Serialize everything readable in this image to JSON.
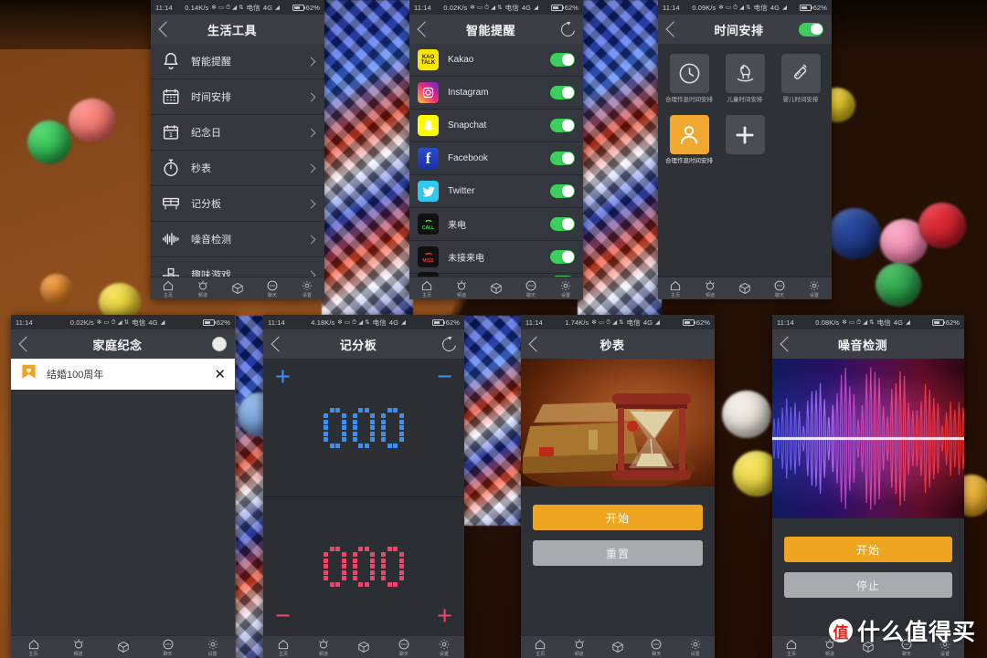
{
  "background": {
    "description": "colorful pom-pom balls on brown wooden table with blue and red LED light panel"
  },
  "watermark": {
    "logo_char": "值",
    "text": "什么值得买"
  },
  "status_bars": [
    {
      "time": "11:14",
      "net_speed": "0.14K/s",
      "carrier": "电信",
      "network": "4G",
      "battery": "62%"
    },
    {
      "time": "11:14",
      "net_speed": "0.02K/s",
      "carrier": "电信",
      "network": "4G",
      "battery": "62%"
    },
    {
      "time": "11:14",
      "net_speed": "0.09K/s",
      "carrier": "电信",
      "network": "4G",
      "battery": "62%"
    },
    {
      "time": "11:14",
      "net_speed": "0.02K/s",
      "carrier": "电信",
      "network": "4G",
      "battery": "62%"
    },
    {
      "time": "11:14",
      "net_speed": "4.18K/s",
      "carrier": "电信",
      "network": "4G",
      "battery": "62%"
    },
    {
      "time": "11:14",
      "net_speed": "1.74K/s",
      "carrier": "电信",
      "network": "4G",
      "battery": "62%"
    },
    {
      "time": "11:14",
      "net_speed": "0.08K/s",
      "carrier": "电信",
      "network": "4G",
      "battery": "62%"
    }
  ],
  "nav_bar": {
    "items": [
      {
        "label": "主页",
        "icon": "home-icon"
      },
      {
        "label": "频道",
        "icon": "brightness-icon"
      },
      {
        "label": "",
        "icon": "cube-icon"
      },
      {
        "label": "聊天",
        "icon": "chat-dots-icon"
      },
      {
        "label": "设置",
        "icon": "gear-icon"
      }
    ]
  },
  "panel_life_tools": {
    "title": "生活工具",
    "items": [
      {
        "label": "智能提醒",
        "icon": "bell-icon"
      },
      {
        "label": "时间安排",
        "icon": "calendar-icon"
      },
      {
        "label": "纪念日",
        "icon": "calendar-one-icon"
      },
      {
        "label": "秒表",
        "icon": "stopwatch-icon"
      },
      {
        "label": "记分板",
        "icon": "scoreboard-icon"
      },
      {
        "label": "噪音检测",
        "icon": "waveform-icon"
      },
      {
        "label": "趣味游戏",
        "icon": "blocks-icon"
      }
    ]
  },
  "panel_smart_reminder": {
    "title": "智能提醒",
    "refresh_icon": "refresh-icon",
    "apps": [
      {
        "name": "Kakao",
        "icon": "kakao-icon",
        "enabled": true
      },
      {
        "name": "Instagram",
        "icon": "instagram-icon",
        "enabled": true
      },
      {
        "name": "Snapchat",
        "icon": "snapchat-icon",
        "enabled": true
      },
      {
        "name": "Facebook",
        "icon": "facebook-icon",
        "enabled": true
      },
      {
        "name": "Twitter",
        "icon": "twitter-icon",
        "enabled": true
      },
      {
        "name": "来电",
        "icon": "call-icon",
        "enabled": true
      },
      {
        "name": "未接来电",
        "icon": "missed-call-icon",
        "enabled": true
      },
      {
        "name": "",
        "icon": "sms-icon",
        "enabled": true
      }
    ]
  },
  "panel_time_arrange": {
    "title": "时间安排",
    "master_toggle": true,
    "tiles": [
      {
        "caption": "合理作息时间安排",
        "icon": "clock-icon",
        "selected": false
      },
      {
        "caption": "儿童时间安排",
        "icon": "rocking-horse-icon",
        "selected": false
      },
      {
        "caption": "婴儿时间安排",
        "icon": "baby-bottle-icon",
        "selected": false
      },
      {
        "caption": "合理作息时间安排",
        "icon": "person-icon",
        "selected": true
      },
      {
        "caption": "",
        "icon": "plus-icon",
        "selected": false
      }
    ]
  },
  "panel_family_anniversary": {
    "title": "家庭纪念",
    "avatar_icon": "avatar-icon",
    "entry": {
      "label": "结婚100周年",
      "badge_icon": "shield-heart-icon",
      "close_icon": "close-icon"
    }
  },
  "panel_scoreboard": {
    "title": "记分板",
    "refresh_icon": "refresh-icon",
    "top": {
      "score": "000",
      "color": "#3d8ef0",
      "plus": "+",
      "minus": "−"
    },
    "bottom": {
      "score": "000",
      "color": "#f2436b",
      "plus": "+",
      "minus": "−"
    }
  },
  "panel_stopwatch": {
    "title": "秒表",
    "hero": "hourglass-books-image",
    "buttons": [
      {
        "label": "开始",
        "style": "primary"
      },
      {
        "label": "重置",
        "style": "secondary"
      }
    ]
  },
  "panel_noise": {
    "title": "噪音检测",
    "hero": "sound-waveform-image",
    "buttons": [
      {
        "label": "开始",
        "style": "primary"
      },
      {
        "label": "停止",
        "style": "secondary"
      }
    ]
  }
}
